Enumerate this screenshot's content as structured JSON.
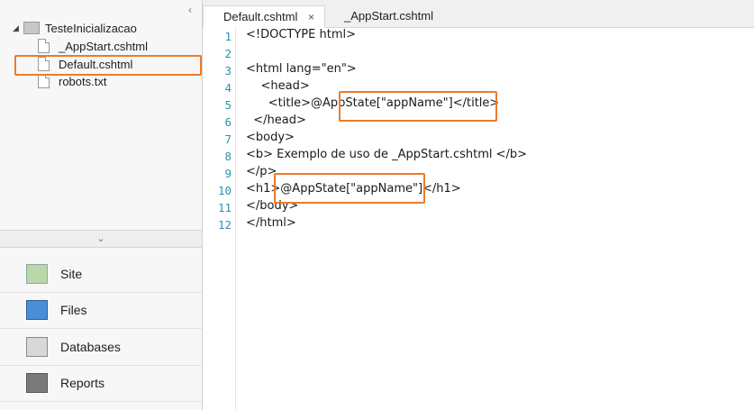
{
  "tree": {
    "root": "TesteInicializacao",
    "files": [
      "_AppStart.cshtml",
      "Default.cshtml",
      "robots.txt"
    ],
    "collapse_glyph": "‹",
    "root_glyph": "◢"
  },
  "splitter": {
    "glyph": "⌄"
  },
  "workspaces": [
    {
      "label": "Site",
      "icon": "site-icon"
    },
    {
      "label": "Files",
      "icon": "files-icon"
    },
    {
      "label": "Databases",
      "icon": "databases-icon"
    },
    {
      "label": "Reports",
      "icon": "reports-icon"
    }
  ],
  "tabs": [
    {
      "label": "Default.cshtml",
      "close": "×"
    },
    {
      "label": "_AppStart.cshtml"
    }
  ],
  "editor": {
    "line_numbers": [
      "1",
      "2",
      "3",
      "4",
      "5",
      "6",
      "7",
      "8",
      "9",
      "10",
      "11",
      "12"
    ],
    "lines": [
      "<!DOCTYPE html>",
      "",
      "<html lang=\"en\">",
      "    <head>",
      "      <title>@AppState[\"appName\"]</title>",
      "  </head>",
      "<body>",
      "<b> Exemplo de uso de _AppStart.cshtml </b>",
      "</p>",
      "<h1>@AppState[\"appName\"]</h1>",
      "</body>",
      "</html>"
    ]
  },
  "colors": {
    "accent": "#ee7a2b",
    "tag": "#1a1a1a",
    "attr_value": "#1c5fd6",
    "string": "#a31515",
    "razor_at": "#f2e16a",
    "line_number": "#2b91af"
  }
}
